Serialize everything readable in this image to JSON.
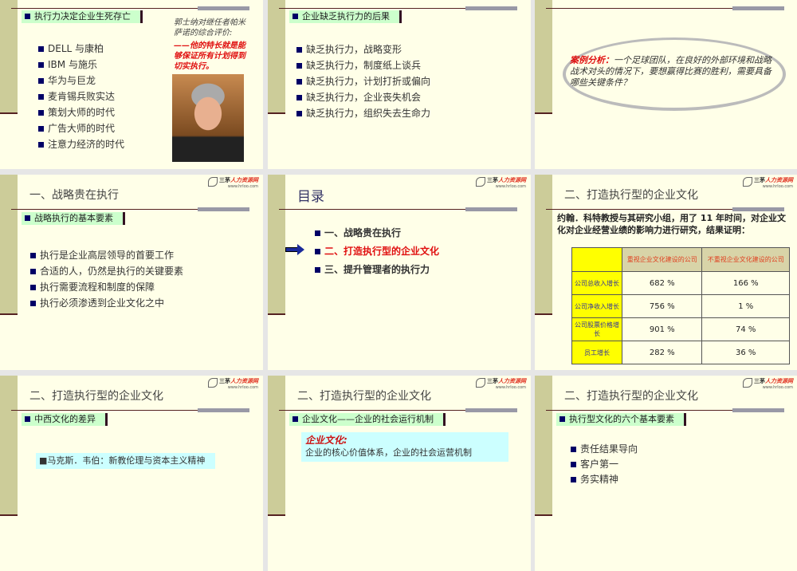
{
  "logo": {
    "name": "三茅",
    "accent": "人力资源网",
    "url": "www.hrloo.com"
  },
  "slides": [
    {
      "header": "执行力决定企业生死存亡",
      "bullets": [
        "DELL 与康柏",
        "IBM 与施乐",
        "华为与巨龙",
        "麦肯锡兵败实达",
        "策划大师的时代",
        "广告大师的时代",
        "注意力经济的时代"
      ],
      "quote": "郭士纳对继任者帕米萨诺的综合评价:",
      "quote_red": "——他的特长就是能够保证所有计划得到切实执行。"
    },
    {
      "header": "企业缺乏执行力的后果",
      "bullets": [
        "缺乏执行力，战略变形",
        "缺乏执行力，制度纸上谈兵",
        "缺乏执行力，计划打折或偏向",
        "缺乏执行力，企业丧失机会",
        "缺乏执行力，组织失去生命力"
      ]
    },
    {
      "case_label": "案例分析：",
      "case_text": "一个足球团队，在良好的外部环境和战略战术对头的情况下，要想赢得比赛的胜利，需要具备哪些关键条件？"
    },
    {
      "title": "一、战略贵在执行",
      "header": "战略执行的基本要素",
      "bullets": [
        "执行是企业高层领导的首要工作",
        "合适的人，仍然是执行的关键要素",
        "执行需要流程和制度的保障",
        "执行必须渗透到企业文化之中"
      ]
    },
    {
      "title": "目录",
      "items": [
        "一、战略贵在执行",
        "二、打造执行型的企业文化",
        "三、提升管理者的执行力"
      ]
    },
    {
      "title": "二、打造执行型的企业文化",
      "intro": "约翰．科特教授与其研究小组，用了 11 年时间，对企业文化对企业经营业绩的影响力进行研究，结果证明：",
      "table": {
        "headers": [
          "",
          "重视企业文化建设的公司",
          "不重视企业文化建设的公司"
        ],
        "rows": [
          [
            "公司总收入增长",
            "682 %",
            "166 %"
          ],
          [
            "公司净收入增长",
            "756 %",
            "1 %"
          ],
          [
            "公司股票价格增长",
            "901 %",
            "74 %"
          ],
          [
            "员工增长",
            "282 %",
            "36 %"
          ]
        ]
      }
    },
    {
      "title": "二、打造执行型的企业文化",
      "header": "中西文化的差异",
      "box": "■马克斯．韦伯：新教伦理与资本主义精神"
    },
    {
      "title": "二、打造执行型的企业文化",
      "header": "企业文化——企业的社会运行机制",
      "box_label": "企业文化:",
      "box": "企业的核心价值体系，企业的社会运营机制"
    },
    {
      "title": "二、打造执行型的企业文化",
      "header": "执行型文化的六个基本要素",
      "bullets": [
        "责任结果导向",
        "客户第一",
        "务实精神"
      ]
    }
  ]
}
